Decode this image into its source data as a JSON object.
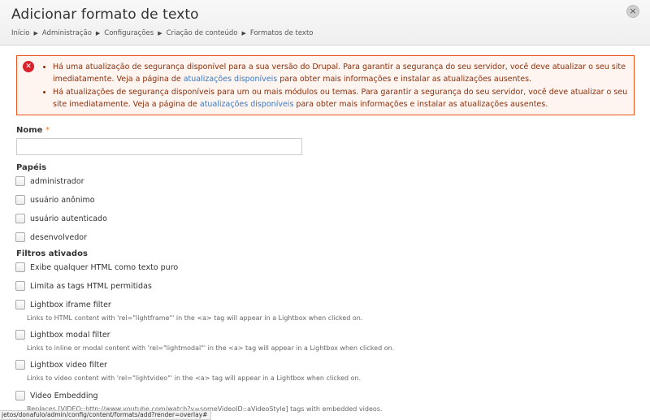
{
  "header": {
    "title": "Adicionar formato de texto",
    "close_glyph": "×",
    "breadcrumb": [
      "Início",
      "Administração",
      "Configurações",
      "Criação de conteúdo",
      "Formatos de texto"
    ],
    "breadcrumb_sep": "▶"
  },
  "messages": {
    "icon_glyph": "✕",
    "items": [
      {
        "before": "Há uma atualização de segurança disponível para a sua versão do Drupal. Para garantir a segurança do seu servidor, você deve atualizar o seu site imediatamente. Veja a página de ",
        "link": "atualizações disponíveis",
        "after": " para obter mais informações e instalar as atualizações ausentes."
      },
      {
        "before": "Há atualizações de segurança disponíveis para um ou mais módulos ou temas. Para garantir a segurança do seu servidor, você deve atualizar o seu site imediatamente. Veja a página de ",
        "link": "atualizações disponíveis",
        "after": " para obter mais informações e instalar as atualizações ausentes."
      }
    ]
  },
  "form": {
    "name_label": "Nome",
    "required_mark": "*",
    "name_value": "",
    "roles_label": "Papéis",
    "roles": [
      "administrador",
      "usuário anônimo",
      "usuário autenticado",
      "desenvolvedor"
    ],
    "filters_label": "Filtros ativados",
    "filters": [
      {
        "label": "Exibe qualquer HTML como texto puro",
        "desc": ""
      },
      {
        "label": "Limita as tags HTML permitidas",
        "desc": ""
      },
      {
        "label": "Lightbox iframe filter",
        "desc": "Links to HTML content with 'rel=\"lightframe\"' in the <a> tag will appear in a Lightbox when clicked on."
      },
      {
        "label": "Lightbox modal filter",
        "desc": "Links to inline or modal content with 'rel=\"lightmodal\"' in the <a> tag will appear in a Lightbox when clicked on."
      },
      {
        "label": "Lightbox video filter",
        "desc": "Links to video content with 'rel=\"lightvideo\"' in the <a> tag will appear in a Lightbox when clicked on."
      },
      {
        "label": "Video Embedding",
        "desc": "Replaces [VIDEO::http://www.youtube.com/watch?v=someVideoID::aVideoStyle] tags with embedded videos."
      }
    ]
  },
  "status_bar": {
    "url": "jetos/donafulo/admin/config/content/formats/add?render=overlay#"
  }
}
